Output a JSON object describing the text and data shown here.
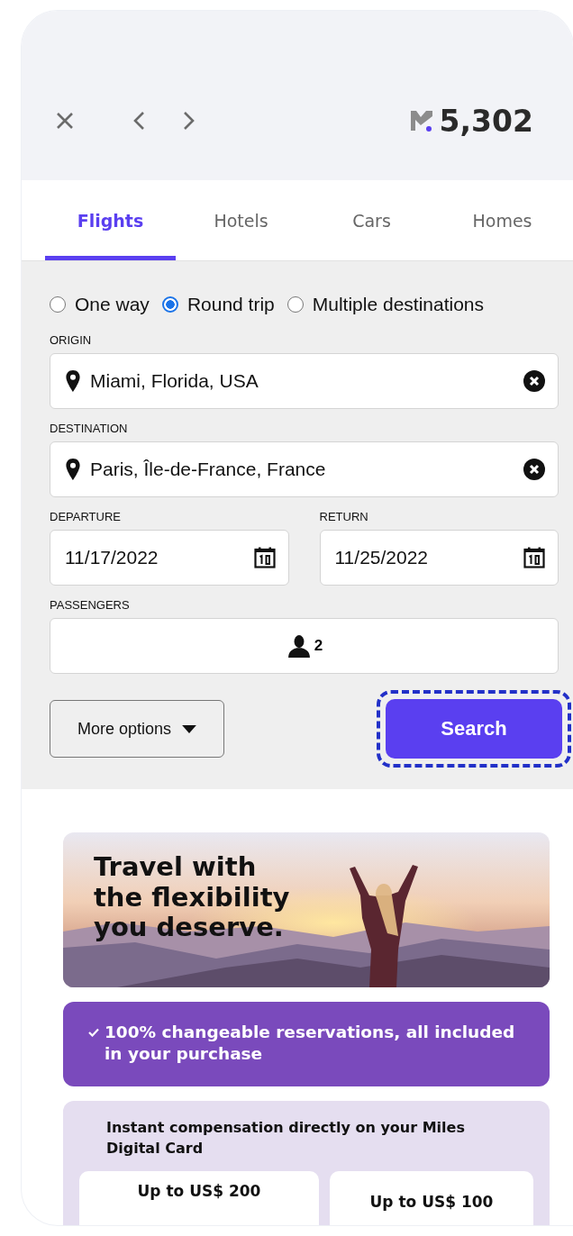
{
  "header": {
    "miles_balance": "5,302"
  },
  "tabs": [
    {
      "label": "Flights",
      "selected": true
    },
    {
      "label": "Hotels",
      "selected": false
    },
    {
      "label": "Cars",
      "selected": false
    },
    {
      "label": "Homes",
      "selected": false
    }
  ],
  "trip_types": [
    {
      "label": "One way",
      "selected": false
    },
    {
      "label": "Round trip",
      "selected": true
    },
    {
      "label": "Multiple destinations",
      "selected": false
    }
  ],
  "origin": {
    "label": "ORIGIN",
    "value": "Miami, Florida, USA"
  },
  "destination": {
    "label": "DESTINATION",
    "value": "Paris, Île-de-France, France"
  },
  "departure": {
    "label": "DEPARTURE",
    "value": "11/17/2022"
  },
  "return": {
    "label": "RETURN",
    "value": "11/25/2022"
  },
  "passengers": {
    "label": "PASSENGERS",
    "value": "2"
  },
  "more_options_button": {
    "label": "More options"
  },
  "search_button": {
    "label": "Search",
    "focused": true
  },
  "promo": {
    "headline": "Travel with the flexibility you deserve.",
    "feature": "100% changeable reservations, all included in your purchase",
    "compensation_title": "Instant compensation directly on your Miles Digital Card",
    "offers": [
      "Up to US$ 200",
      "Up to US$ 100"
    ]
  }
}
